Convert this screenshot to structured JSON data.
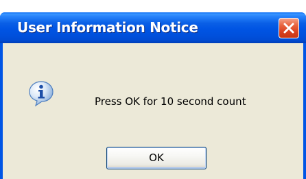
{
  "dialog": {
    "title": "User Information Notice",
    "message": "Press OK for 10 second count",
    "ok_label": "OK",
    "icon": "information-icon",
    "close_icon": "close-icon"
  },
  "colors": {
    "titlebar_blue": "#0054e3",
    "dialog_face": "#ece9d8",
    "close_red": "#d9401f",
    "button_border": "#003c74"
  }
}
